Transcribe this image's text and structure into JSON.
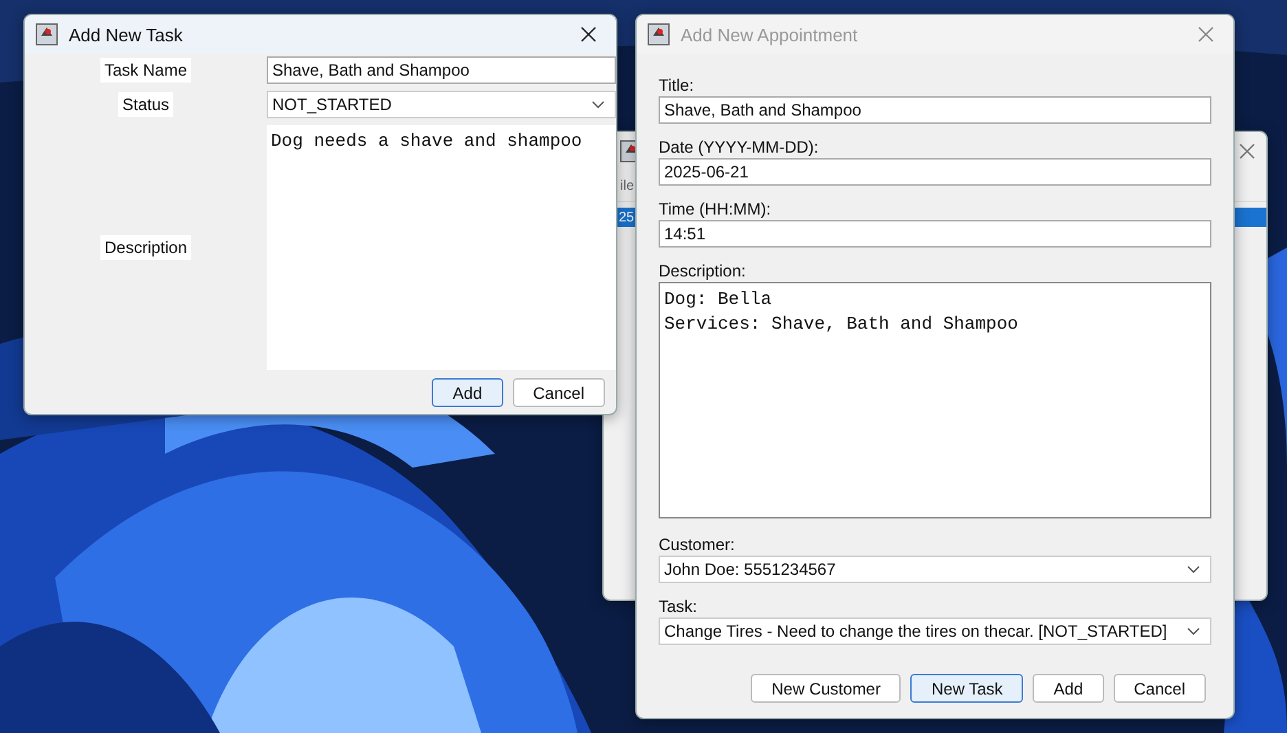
{
  "task_dialog": {
    "title": "Add New Task",
    "active": true,
    "fields": [
      {
        "kind": "text",
        "label": "Task Name",
        "value": "Shave, Bath and Shampoo"
      },
      {
        "kind": "select",
        "label": "Status",
        "value": "NOT_STARTED"
      },
      {
        "kind": "textarea",
        "label": "Description",
        "value": "Dog needs a shave and shampoo"
      }
    ],
    "buttons": [
      {
        "label": "Add",
        "default": true
      },
      {
        "label": "Cancel",
        "default": false
      }
    ]
  },
  "background_window": {
    "menu_fragment": "ile",
    "cell_fragment": "25"
  },
  "appointment_dialog": {
    "title": "Add New Appointment",
    "active": false,
    "fields": [
      {
        "kind": "text",
        "label": "Title:",
        "value": "Shave, Bath and Shampoo"
      },
      {
        "kind": "text",
        "label": "Date (YYYY-MM-DD):",
        "value": "2025-06-21"
      },
      {
        "kind": "text",
        "label": "Time (HH:MM):",
        "value": "14:51"
      },
      {
        "kind": "textarea",
        "label": "Description:",
        "value": "Dog: Bella\nServices: Shave, Bath and Shampoo"
      },
      {
        "kind": "select",
        "label": "Customer:",
        "value": "John Doe: 5551234567"
      },
      {
        "kind": "select",
        "label": "Task:",
        "value": "Change Tires - Need to change the tires on thecar. [NOT_STARTED]"
      }
    ],
    "buttons": [
      {
        "label": "New Customer",
        "default": false
      },
      {
        "label": "New Task",
        "default": true
      },
      {
        "label": "Add",
        "default": false
      },
      {
        "label": "Cancel",
        "default": false
      }
    ]
  }
}
